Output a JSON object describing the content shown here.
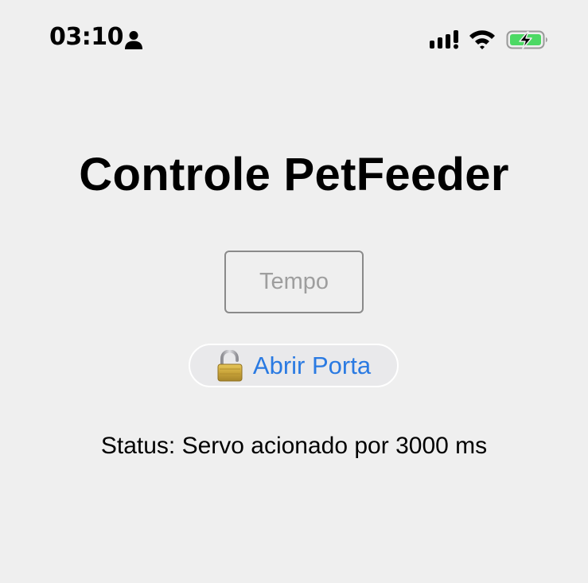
{
  "status_bar": {
    "time": "03:10",
    "icons": [
      "person-icon",
      "cellular-signal-icon",
      "wifi-icon",
      "battery-charging-icon"
    ],
    "battery_color": "#4cd964"
  },
  "main": {
    "title": "Controle PetFeeder",
    "tempo_input": {
      "value": "",
      "placeholder": "Tempo"
    },
    "open_button": {
      "icon": "open-padlock-icon",
      "label": "Abrir Porta",
      "label_color": "#2a7ae2"
    },
    "status_text": "Status: Servo acionado por 3000 ms"
  }
}
